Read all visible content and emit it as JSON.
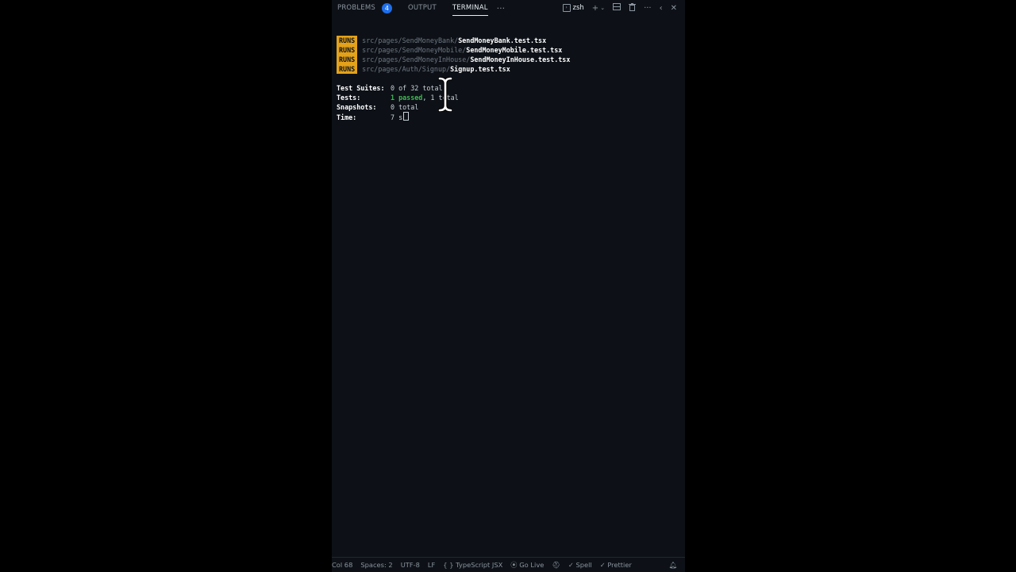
{
  "tabs": {
    "problems": "PROBLEMS",
    "problems_count": "4",
    "output": "OUTPUT",
    "terminal": "TERMINAL",
    "more": "···"
  },
  "shell": {
    "name": "zsh"
  },
  "terminal": {
    "runs": [
      {
        "badge": "RUNS",
        "path": "src/pages/SendMoneyBank/",
        "file": "SendMoneyBank.test.tsx"
      },
      {
        "badge": "RUNS",
        "path": "src/pages/SendMoneyMobile/",
        "file": "SendMoneyMobile.test.tsx"
      },
      {
        "badge": "RUNS",
        "path": "src/pages/SendMoneyInHouse/",
        "file": "SendMoneyInHouse.test.tsx"
      },
      {
        "badge": "RUNS",
        "path": "src/pages/Auth/Signup/",
        "file": "Signup.test.tsx"
      }
    ],
    "summary": {
      "suites_label": "Test Suites:",
      "suites_value": "0 of 32 total",
      "tests_label": "Tests:",
      "tests_passed": "1 passed",
      "tests_rest": ", 1 total",
      "snapshots_label": "Snapshots:",
      "snapshots_value": "0 total",
      "time_label": "Time:",
      "time_value": "7 s"
    }
  },
  "statusbar": {
    "col": "Col 68",
    "spaces": "Spaces: 2",
    "encoding": "UTF-8",
    "eol": "LF",
    "language": "TypeScript JSX",
    "golive": "Go Live",
    "spell": "Spell",
    "prettier": "Prettier"
  }
}
